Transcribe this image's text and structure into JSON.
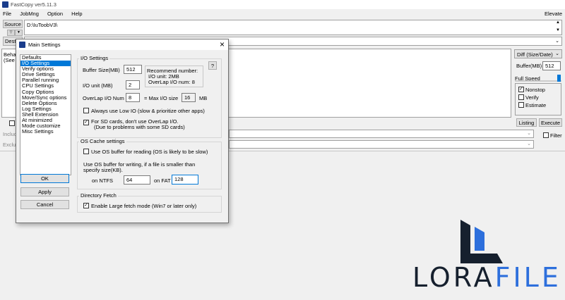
{
  "app": {
    "title": "FastCopy ver5.11.3",
    "menu": [
      "File",
      "JobMng",
      "Option",
      "Help"
    ],
    "elevate": "Elevate",
    "source_button": "Source",
    "dest_button": "DestDir",
    "source_path": "D:\\IuToobV3\\",
    "behavior_text": [
      "Behav",
      "(See M"
    ],
    "include_label": "Includ",
    "exclude_label": "Exclud",
    "mode": "Diff (Size/Date)",
    "buffer_label": "Buffer(MB)",
    "buffer_value": "512",
    "speed_label": "Full Speed",
    "nonstop": "Nonstop",
    "verify": "Verify",
    "estimate": "Estimate",
    "listing": "Listing",
    "execute": "Execute",
    "filter": "Filter"
  },
  "dialog": {
    "title": "Main Settings",
    "close": "×",
    "nav": [
      "Defaults",
      "I/O Settings",
      "Verify options",
      "Drive Settings",
      "Parallel running",
      "CPU Settings",
      "Copy Options",
      "Move/Sync options",
      "Delete Options",
      "Log Settings",
      "Shell Extension",
      "At minimized",
      "Mode customize",
      "Misc Settings"
    ],
    "ok": "OK",
    "apply": "Apply",
    "cancel": "Cancel",
    "io": {
      "group_label": "I/O Settings",
      "buffer_label": "Buffer Size(MB)",
      "buffer_value": "512",
      "io_unit_label": "I/O unit (MB)",
      "io_unit_value": "2",
      "overlap_label": "OverLap I/O Num",
      "overlap_value": "8",
      "max_io_label": "= Max I/O size",
      "max_io_value": "16",
      "max_io_unit": "MB",
      "recommend_title": "Recommend number:",
      "recommend_unit": "I/O unit: 2MB",
      "recommend_overlap": "OverLap I/O num: 8",
      "help": "?",
      "low_io": "Always use Low IO (slow & prioritize other apps)",
      "sd_line1": "For SD cards, don't use OverLap I/O.",
      "sd_line2": "(Due to problems with some SD cards)"
    },
    "cache": {
      "group_label": "OS Cache settings",
      "use_os_buffer": "Use OS buffer for reading (OS is likely to be slow)",
      "writing_line1": "Use OS buffer for writing, if a file is smaller than",
      "writing_line2": "specify size(KB).",
      "ntfs_label": "on NTFS",
      "ntfs_value": "64",
      "fat_label": "on FAT",
      "fat_value": "128"
    },
    "fetch": {
      "group_label": "Directory Fetch",
      "large_fetch": "Enable Large fetch mode (Win7 or later only)"
    }
  },
  "watermark": {
    "text_dark": "LORA",
    "text_blue": "FILE",
    "colors": {
      "dark": "#16202e",
      "blue": "#2d6fdc"
    }
  }
}
